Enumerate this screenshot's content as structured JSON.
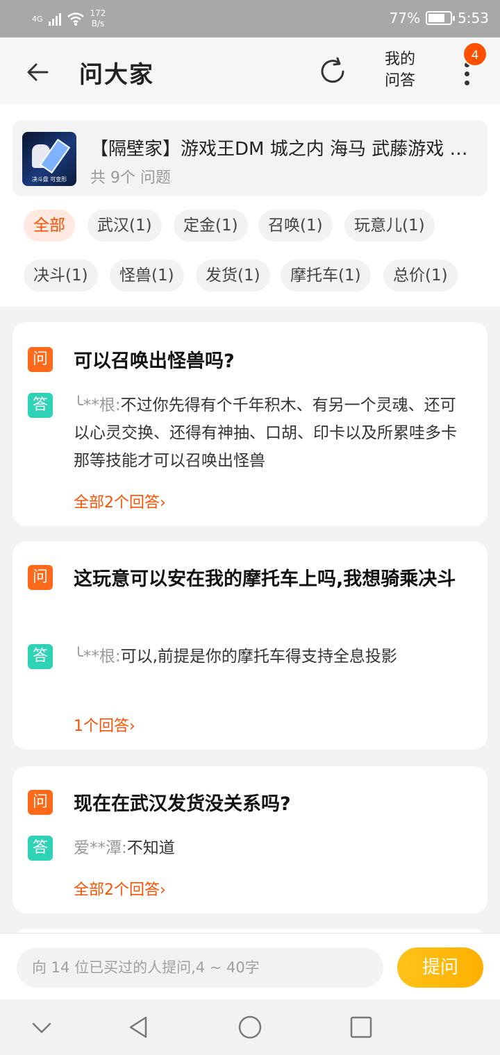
{
  "status_bar": {
    "network": "4G",
    "speed_value": "172",
    "speed_unit": "B/s",
    "battery": "77%",
    "battery_level": 0.77,
    "time": "5:53"
  },
  "nav": {
    "title": "问大家",
    "my_qa_line1": "我的",
    "my_qa_line2": "问答",
    "badge_count": "4"
  },
  "product": {
    "title": "【隔壁家】游戏王DM 城之内 海马 武藤游戏 黑魔导 青眼白龙 决斗盘 可变形",
    "count_text": "共 9个 问题",
    "thumb_caption": "决斗盘 可变形"
  },
  "tags": [
    {
      "label": "全部",
      "active": true
    },
    {
      "label": "武汉(1)",
      "active": false
    },
    {
      "label": "定金(1)",
      "active": false
    },
    {
      "label": "召唤(1)",
      "active": false
    },
    {
      "label": "玩意儿(1)",
      "active": false
    },
    {
      "label": "决斗(1)",
      "active": false
    },
    {
      "label": "怪兽(1)",
      "active": false
    },
    {
      "label": "发货(1)",
      "active": false
    },
    {
      "label": "摩托车(1)",
      "active": false
    },
    {
      "label": "总价(1)",
      "active": false
    }
  ],
  "qa": [
    {
      "q_badge": "问",
      "a_badge": "答",
      "question": "可以召唤出怪兽吗?",
      "user": "╰**根:",
      "answer": "不过你先得有个千年积木、有另一个灵魂、还可以心灵交换、还得有神抽、口胡、印卡以及所累哇多卡那等技能才可以召唤出怪兽",
      "more": "全部2个回答›"
    },
    {
      "q_badge": "问",
      "a_badge": "答",
      "question": "这玩意可以安在我的摩托车上吗,我想骑乘决斗",
      "user": "╰**根:",
      "answer": "可以,前提是你的摩托车得支持全息投影",
      "more": "1个回答›"
    },
    {
      "q_badge": "问",
      "a_badge": "答",
      "question": "现在在武汉发货没关系吗?",
      "user": "爱**潭:",
      "answer": "不知道",
      "more": "全部2个回答›"
    }
  ],
  "ask": {
    "placeholder": "向 14 位已买过的人提问,4 ~ 40字",
    "button": "提问"
  },
  "colors": {
    "accent": "#ff5000",
    "ask_button": "#ffb000",
    "question_icon": "#ff6a1a",
    "answer_icon": "#2ed3b6"
  }
}
